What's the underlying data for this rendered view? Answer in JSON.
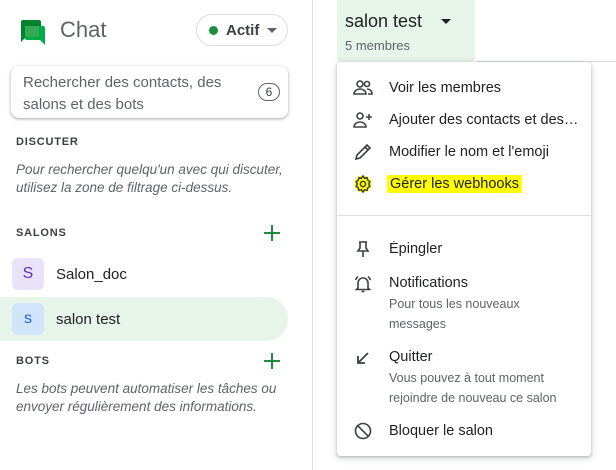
{
  "app": {
    "title": "Chat"
  },
  "status": {
    "label": "Actif",
    "color": "#1e8e3e"
  },
  "search": {
    "placeholder": "Rechercher des contacts, des salons et des bots",
    "count": "6"
  },
  "sections": {
    "discuter": {
      "title": "DISCUTER",
      "note": "Pour rechercher quelqu'un avec qui discuter, utilisez la zone de filtrage ci-dessus."
    },
    "salons": {
      "title": "SALONS",
      "rooms": [
        {
          "initial": "S",
          "name": "Salon_doc",
          "avatar_bg": "#e8e3f8",
          "avatar_fg": "#5e35b1"
        },
        {
          "initial": "s",
          "name": "salon test",
          "avatar_bg": "#d2e3fc",
          "avatar_fg": "#1967d2",
          "selected": true
        }
      ]
    },
    "bots": {
      "title": "BOTS",
      "note": "Les bots peuvent automatiser les tâches ou envoyer régulièrement des informations."
    }
  },
  "room_header": {
    "title": "salon test",
    "subtitle": "5 membres"
  },
  "menu": {
    "items": [
      {
        "icon": "people-icon",
        "label": "Voir les membres"
      },
      {
        "icon": "add-person-icon",
        "label": "Ajouter des contacts et des bots"
      },
      {
        "icon": "pencil-icon",
        "label": "Modifier le nom et l'emoji"
      },
      {
        "icon": "gear-icon",
        "label": "Gérer les webhooks",
        "highlighted": true
      },
      {
        "icon": "pin-icon",
        "label": "Épingler"
      },
      {
        "icon": "bell-icon",
        "label": "Notifications",
        "sub": "Pour tous les nouveaux messages"
      },
      {
        "icon": "exit-arrow-icon",
        "label": "Quitter",
        "sub": "Vous pouvez à tout moment rejoindre de nouveau ce salon"
      },
      {
        "icon": "block-icon",
        "label": "Bloquer le salon"
      }
    ]
  },
  "colors": {
    "accent": "#1e8e3e",
    "selected_bg": "#e6f4ea",
    "highlight": "#ffff00"
  }
}
